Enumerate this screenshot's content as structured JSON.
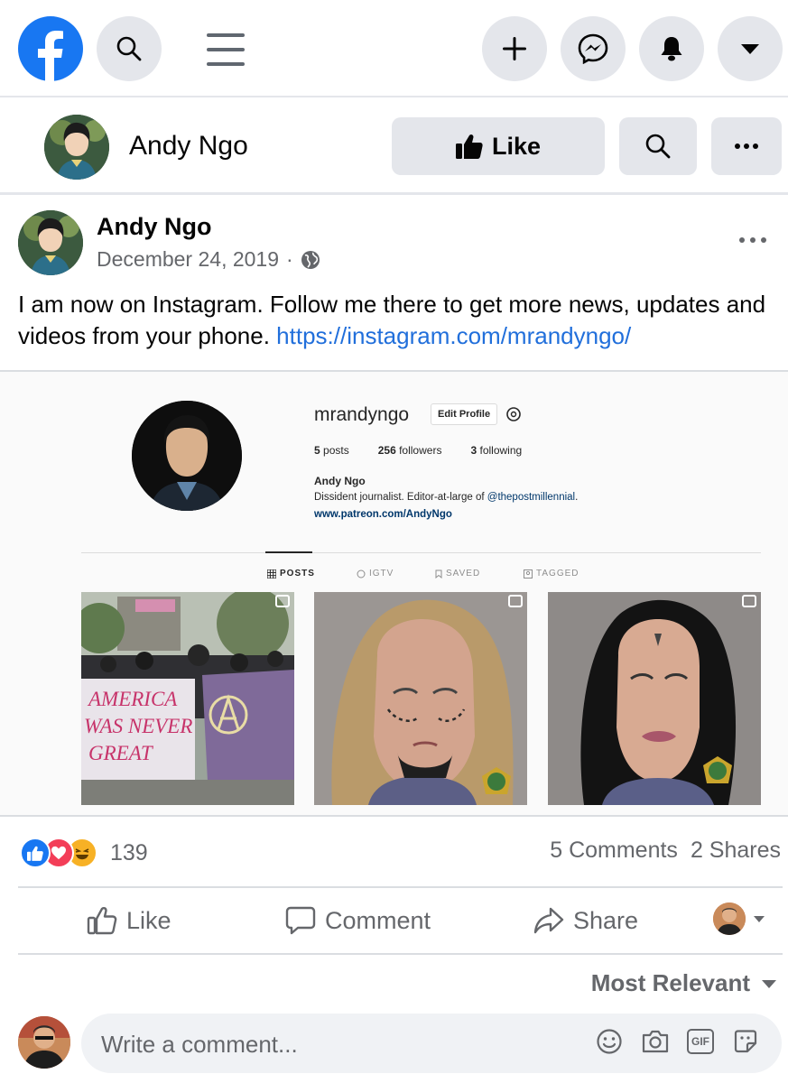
{
  "topbar": {
    "icons": [
      "facebook-logo",
      "search-icon",
      "menu-icon",
      "plus-icon",
      "messenger-icon",
      "bell-icon",
      "caret-down-icon"
    ]
  },
  "page_header": {
    "name": "Andy Ngo",
    "like_label": "Like"
  },
  "post": {
    "author": "Andy Ngo",
    "date": "December 24, 2019",
    "separator": "·",
    "privacy_icon": "globe-icon",
    "text": "I am now on Instagram. Follow me there to get more news, updates and videos from your phone.",
    "link": "https://instagram.com/mrandyngo/"
  },
  "instagram_embed": {
    "username": "mrandyngo",
    "edit_profile": "Edit Profile",
    "posts_count": "5",
    "posts_label": "posts",
    "followers_count": "256",
    "followers_label": "followers",
    "following_count": "3",
    "following_label": "following",
    "full_name": "Andy Ngo",
    "bio_prefix": "Dissident journalist. Editor-at-large of",
    "bio_mention": "@thepostmillennial",
    "bio_suffix": ".",
    "website": "www.patreon.com/AndyNgo",
    "tabs": [
      "POSTS",
      "IGTV",
      "SAVED",
      "TAGGED"
    ],
    "thumb1_sign_text": "AMERICA WAS NEVER GREAT"
  },
  "reactions": {
    "types": [
      "like",
      "love",
      "haha"
    ],
    "count": "139",
    "comments": "5 Comments",
    "shares": "2 Shares"
  },
  "actions": {
    "like": "Like",
    "comment": "Comment",
    "share": "Share"
  },
  "comments": {
    "sort_label": "Most Relevant",
    "placeholder": "Write a comment...",
    "gif_label": "GIF"
  },
  "colors": {
    "brand_blue": "#1877f2",
    "link_blue": "#216fdb",
    "gray_bg": "#e4e6eb",
    "secondary_text": "#65676b"
  }
}
